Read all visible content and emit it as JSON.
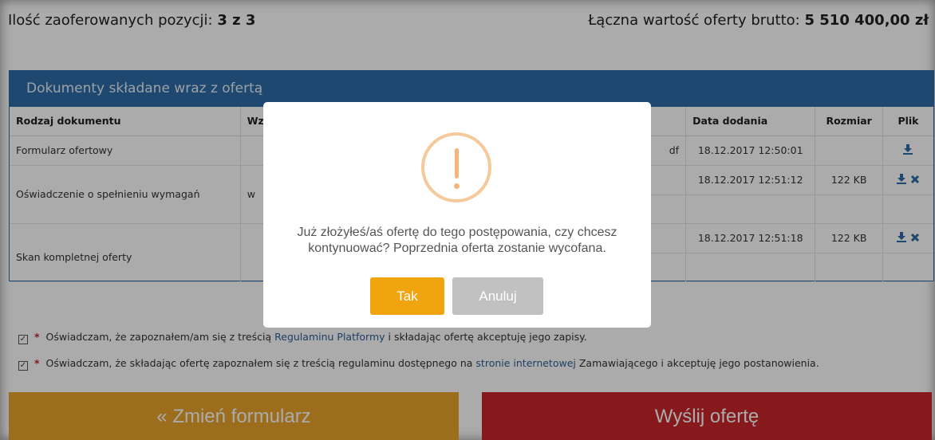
{
  "summary": {
    "count_label": "Ilość zaoferowanych pozycji:",
    "count_value": "3 z 3",
    "total_label": "Łączna wartość oferty brutto:",
    "total_value": "5 510 400,00 zł"
  },
  "documents": {
    "title": "Dokumenty składane wraz z ofertą",
    "columns": {
      "type": "Rodzaj dokumentu",
      "template": "Wzó",
      "date": "Data dodania",
      "size": "Rozmiar",
      "file": "Plik"
    },
    "rows": [
      {
        "type": "Formularz ofertowy",
        "template": "",
        "file_fragment": "df",
        "date": "18.12.2017 12:50:01",
        "size": ""
      },
      {
        "type": "Oświadczenie o spełnieniu wymagań",
        "template": "w",
        "file_fragment": "",
        "date": "18.12.2017 12:51:12",
        "size": "122 KB"
      },
      {
        "type": "Skan kompletnej oferty",
        "template": "",
        "file_fragment": "",
        "date": "18.12.2017 12:51:18",
        "size": "122 KB"
      }
    ],
    "icons": {
      "download": "download-icon",
      "delete": "delete-icon"
    }
  },
  "declarations": {
    "line1_before": "Oświadczam, że zapoznałem/am się z treścią",
    "line1_link": "Regulaminu Platformy",
    "line1_after": "i składając ofertę akceptuję jego zapisy.",
    "line2_before": "Oświadczam, że składając ofertę zapoznałem się z treścią regulaminu dostępnego na",
    "line2_link": "stronie internetowej",
    "line2_after": "Zamawiającego i akceptuję jego postanowienia.",
    "required_mark": "*",
    "check_glyph": "✓"
  },
  "actions": {
    "change_form": "« Zmień formularz",
    "send_offer": "Wyślij ofertę"
  },
  "modal": {
    "icon": "warning-icon",
    "message": "Już złożyłeś/aś ofertę do tego postępowania, czy chcesz kontynuować? Poprzednia oferta zostanie wycofana.",
    "confirm_label": "Tak",
    "cancel_label": "Anuluj"
  },
  "colors": {
    "header_blue": "#2d6ca6",
    "change_button": "#e8a32a",
    "send_button": "#c9262b",
    "confirm_button": "#f0a40f",
    "cancel_button": "#c1c1c1",
    "warning": "#f2b57a"
  }
}
